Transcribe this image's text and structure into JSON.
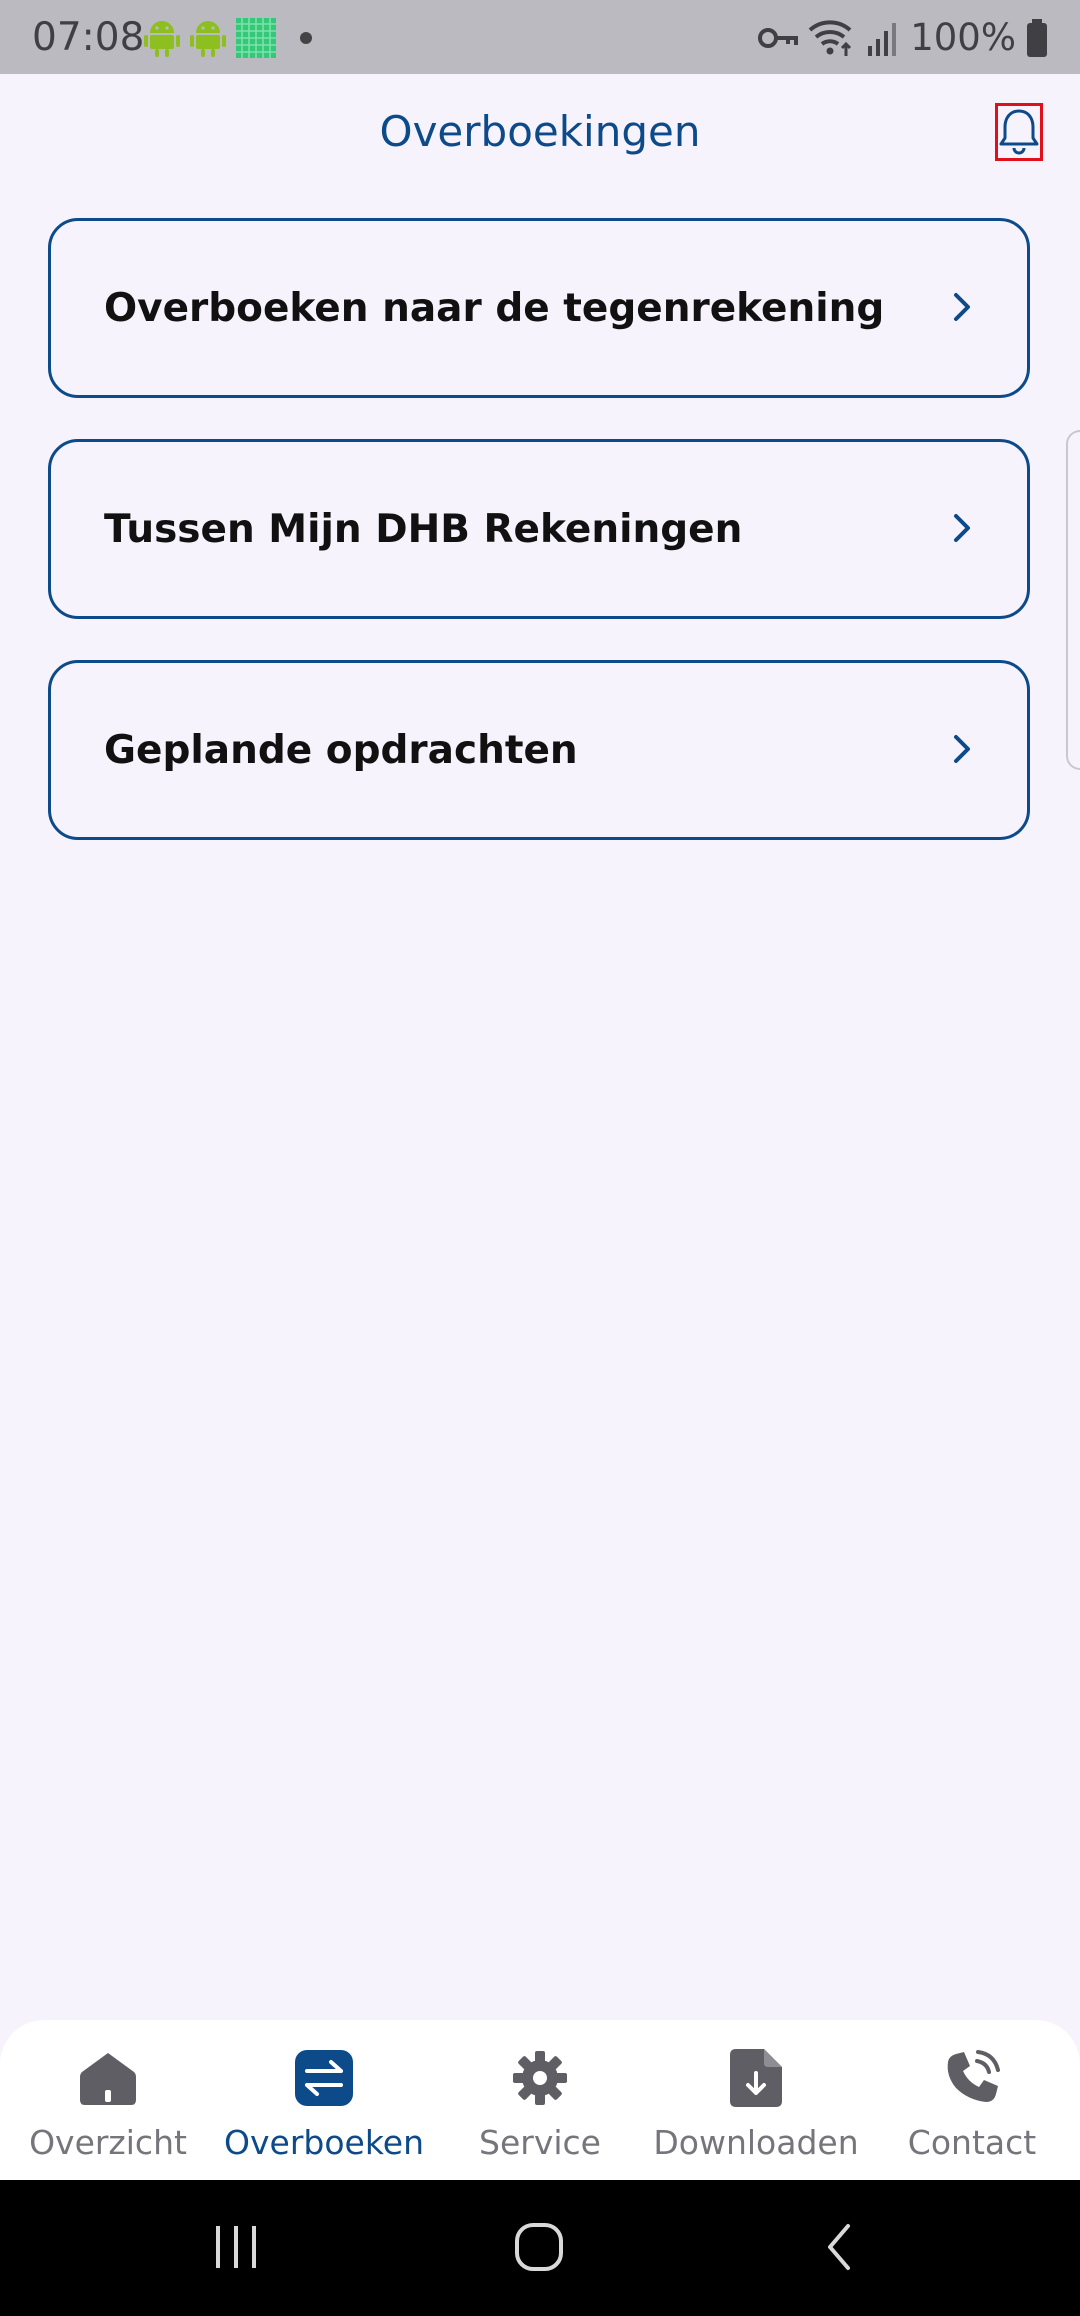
{
  "status_bar": {
    "time": "07:08",
    "battery": "100%",
    "left_icons": [
      "android-icon",
      "android-icon",
      "app-grid-icon",
      "dot-icon"
    ],
    "right_icons": [
      "vpn-key-icon",
      "wifi-icon",
      "signal-icon",
      "battery-icon"
    ]
  },
  "header": {
    "title": "Overboekingen",
    "bell_icon": "bell-icon"
  },
  "menu": {
    "items": [
      {
        "label": "Overboeken naar de tegenrekening"
      },
      {
        "label": "Tussen Mijn DHB Rekeningen"
      },
      {
        "label": "Geplande opdrachten"
      }
    ]
  },
  "bottom_nav": {
    "items": [
      {
        "label": "Overzicht",
        "icon": "home-icon"
      },
      {
        "label": "Overboeken",
        "icon": "transfer-icon",
        "active": true
      },
      {
        "label": "Service",
        "icon": "gear-icon"
      },
      {
        "label": "Downloaden",
        "icon": "download-file-icon"
      },
      {
        "label": "Contact",
        "icon": "phone-icon"
      }
    ]
  },
  "system_nav": {
    "buttons": [
      "recent-apps-icon",
      "home-button-icon",
      "back-icon"
    ]
  },
  "colors": {
    "accent": "#0c4a8a",
    "background": "#f6f3fc",
    "inactive": "#76757c",
    "highlight": "#e0101b"
  }
}
